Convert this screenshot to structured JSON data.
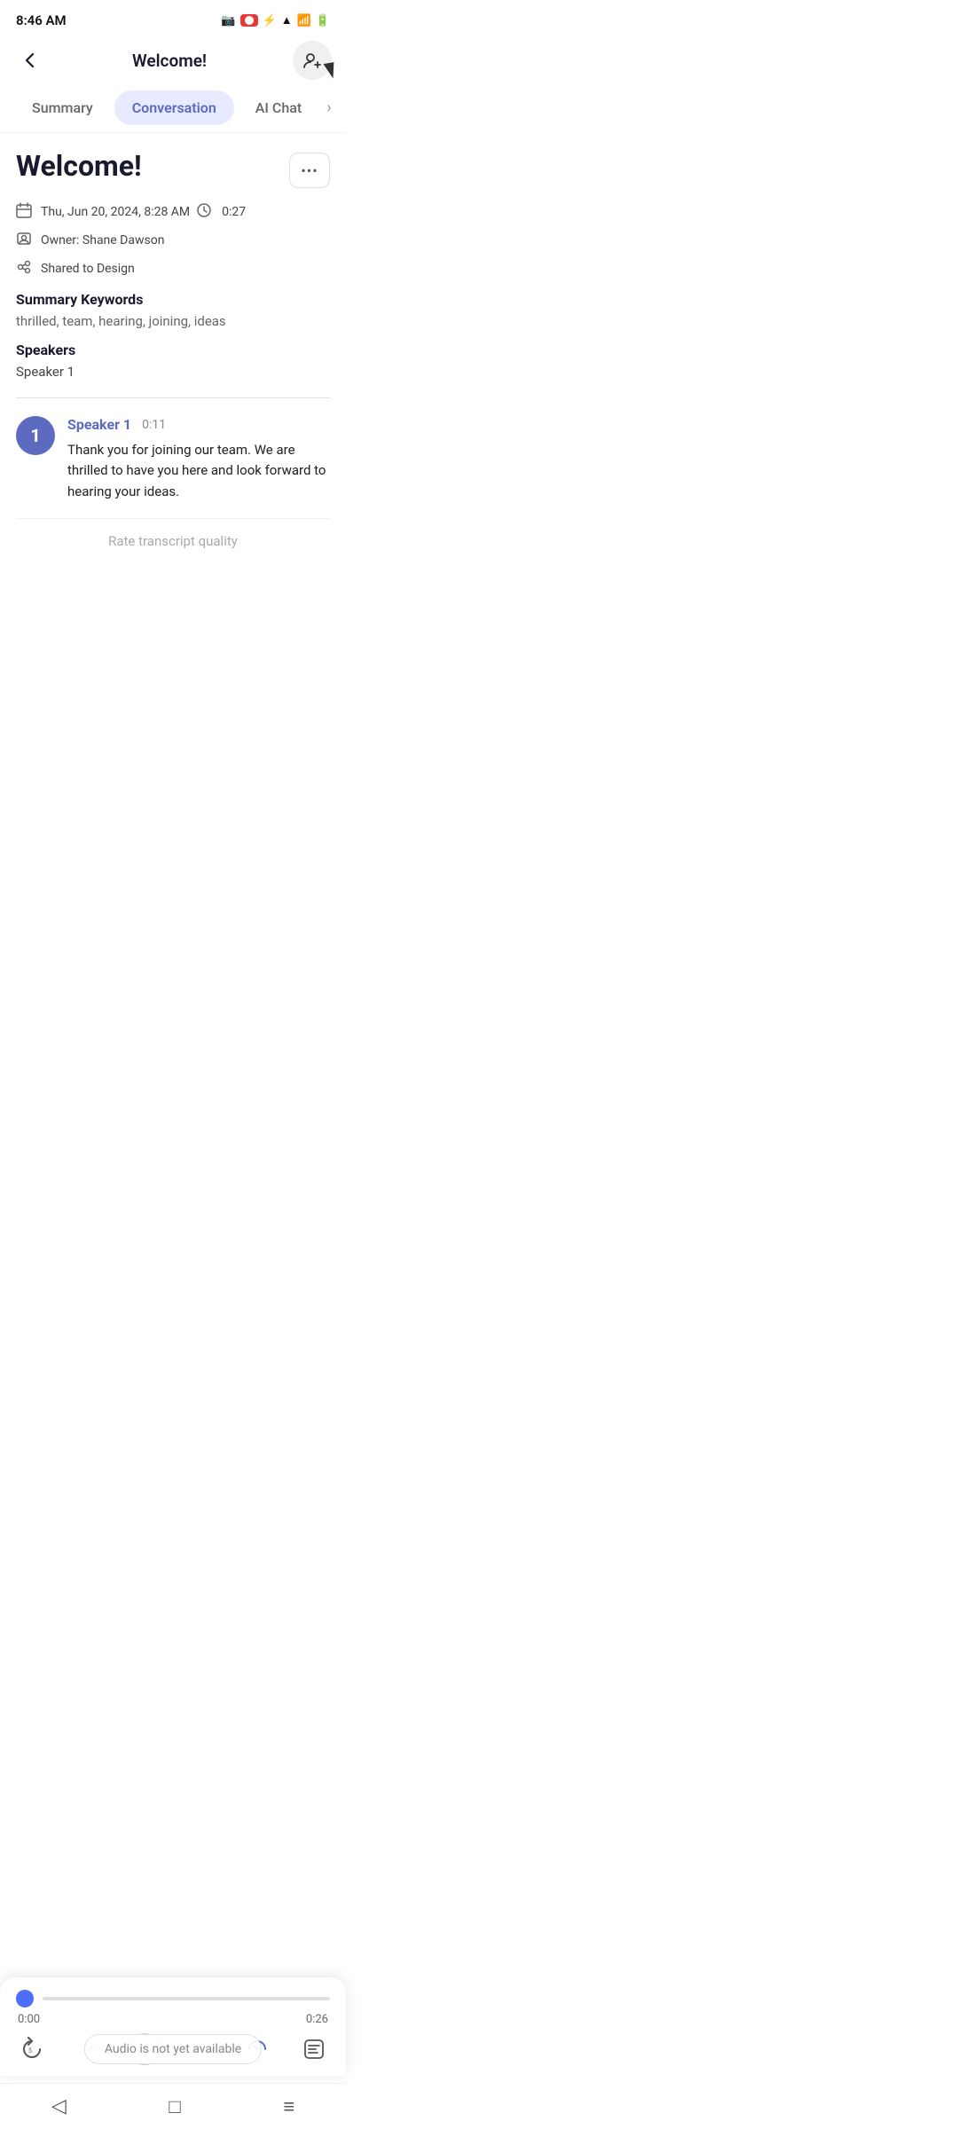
{
  "statusBar": {
    "time": "8:46 AM",
    "icons": [
      "camera",
      "signal",
      "bluetooth",
      "wifi",
      "battery"
    ]
  },
  "header": {
    "title": "Welcome!",
    "backLabel": "←",
    "addLabel": "+👤"
  },
  "tabs": [
    {
      "id": "summary",
      "label": "Summary",
      "active": false
    },
    {
      "id": "conversation",
      "label": "Conversation",
      "active": true
    },
    {
      "id": "aichat",
      "label": "AI Chat",
      "active": false
    }
  ],
  "meeting": {
    "title": "Welcome!",
    "moreLabel": "•••",
    "date": "Thu, Jun 20, 2024, 8:28 AM",
    "duration": "0:27",
    "owner": "Owner: Shane Dawson",
    "shared": "Shared to Design",
    "summaryKeywordsLabel": "Summary Keywords",
    "keywords": "thrilled,  team,  hearing,  joining,  ideas",
    "speakersLabel": "Speakers",
    "speaker": "Speaker 1"
  },
  "message": {
    "speakerNumber": "1",
    "speakerName": "Speaker 1",
    "time": "0:11",
    "text": "Thank you for joining our team. We are thrilled to have you here and look forward to hearing your ideas."
  },
  "rateBar": {
    "label": "Rate transcript quality"
  },
  "audioPlayer": {
    "currentTime": "0:00",
    "totalTime": "0:26",
    "unavailableMsg": "Audio is not yet available"
  },
  "navBar": {
    "backIcon": "◁",
    "homeIcon": "□",
    "menuIcon": "≡"
  }
}
